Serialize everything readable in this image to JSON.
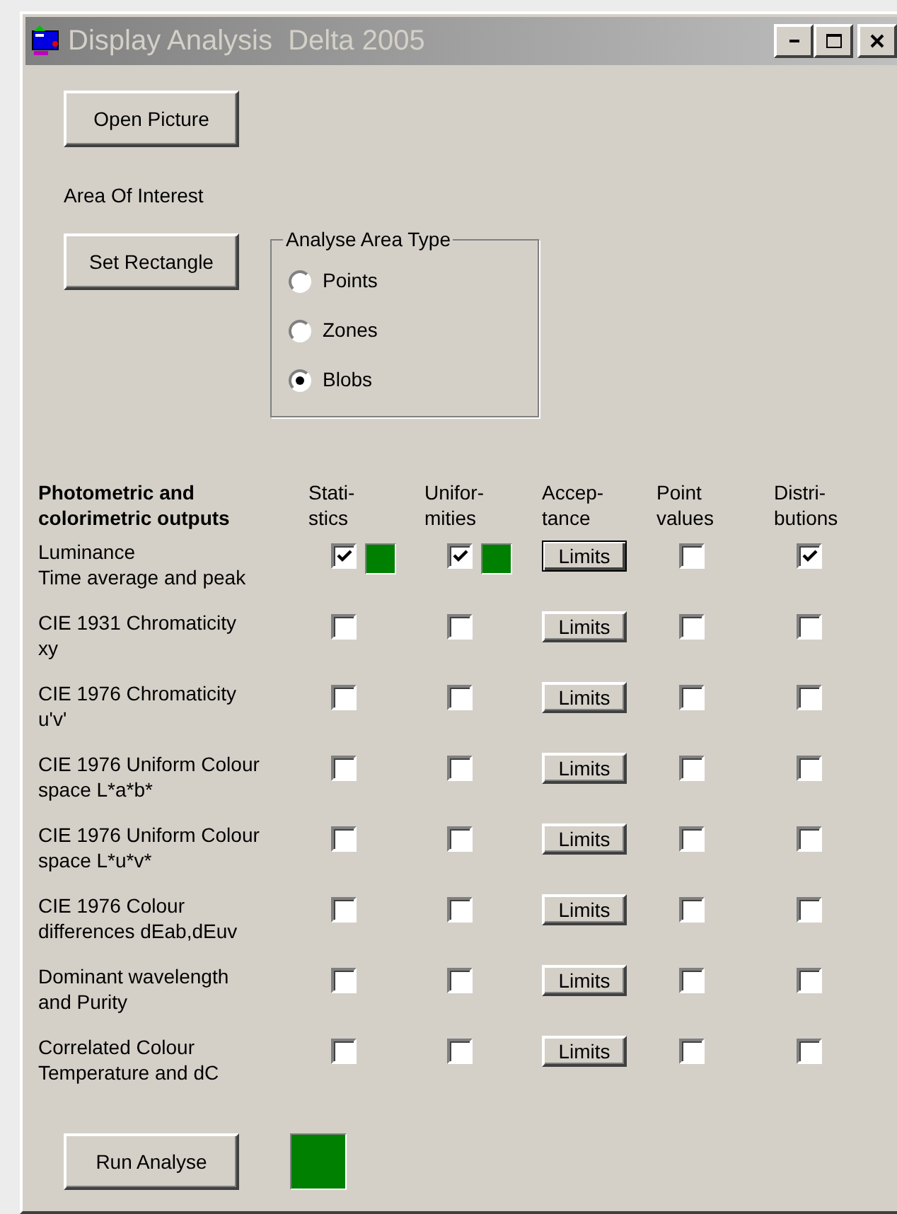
{
  "window": {
    "title": "Display Analysis  Delta 2005"
  },
  "open_button": "Open Picture",
  "area_label": "Area Of Interest",
  "set_rectangle_button": "Set Rectangle",
  "area_type": {
    "legend": "Analyse Area Type",
    "options": [
      {
        "label": "Points",
        "selected": false
      },
      {
        "label": "Zones",
        "selected": false
      },
      {
        "label": "Blobs",
        "selected": true
      }
    ]
  },
  "outputs": {
    "heading": [
      "Photometric and",
      "colorimetric outputs"
    ],
    "columns": [
      {
        "kind": "check",
        "lines": [
          "Stati-",
          "stics"
        ]
      },
      {
        "kind": "check",
        "lines": [
          "Unifor-",
          "mities"
        ]
      },
      {
        "kind": "button",
        "lines": [
          "Accep-",
          "tance"
        ]
      },
      {
        "kind": "check",
        "lines": [
          "Point",
          "values"
        ]
      },
      {
        "kind": "check",
        "lines": [
          "Distri-",
          "butions"
        ]
      }
    ],
    "rows": [
      {
        "lines": [
          "Luminance",
          "Time average and peak"
        ],
        "statistics": {
          "checked": true,
          "indicator": true
        },
        "uniformities": {
          "checked": true,
          "indicator": true
        },
        "limits": {
          "label": "Limits",
          "default": true
        },
        "point_values": {
          "checked": false
        },
        "distributions": {
          "checked": true
        }
      },
      {
        "lines": [
          "CIE 1931 Chromaticity",
          "xy"
        ],
        "statistics": {
          "checked": false
        },
        "uniformities": {
          "checked": false
        },
        "limits": {
          "label": "Limits",
          "default": false
        },
        "point_values": {
          "checked": false
        },
        "distributions": {
          "checked": false
        }
      },
      {
        "lines": [
          "CIE 1976 Chromaticity",
          "u'v'"
        ],
        "statistics": {
          "checked": false
        },
        "uniformities": {
          "checked": false
        },
        "limits": {
          "label": "Limits",
          "default": false
        },
        "point_values": {
          "checked": false
        },
        "distributions": {
          "checked": false
        }
      },
      {
        "lines": [
          "CIE 1976 Uniform Colour",
          "space L*a*b*"
        ],
        "statistics": {
          "checked": false
        },
        "uniformities": {
          "checked": false
        },
        "limits": {
          "label": "Limits",
          "default": false
        },
        "point_values": {
          "checked": false
        },
        "distributions": {
          "checked": false
        }
      },
      {
        "lines": [
          "CIE 1976 Uniform Colour",
          "space L*u*v*"
        ],
        "statistics": {
          "checked": false
        },
        "uniformities": {
          "checked": false
        },
        "limits": {
          "label": "Limits",
          "default": false
        },
        "point_values": {
          "checked": false
        },
        "distributions": {
          "checked": false
        }
      },
      {
        "lines": [
          "CIE 1976 Colour",
          "differences dEab,dEuv"
        ],
        "statistics": {
          "checked": false
        },
        "uniformities": {
          "checked": false
        },
        "limits": {
          "label": "Limits",
          "default": false
        },
        "point_values": {
          "checked": false
        },
        "distributions": {
          "checked": false
        }
      },
      {
        "lines": [
          "Dominant wavelength",
          "and Purity"
        ],
        "statistics": {
          "checked": false
        },
        "uniformities": {
          "checked": false
        },
        "limits": {
          "label": "Limits",
          "default": false
        },
        "point_values": {
          "checked": false
        },
        "distributions": {
          "checked": false
        }
      },
      {
        "lines": [
          "Correlated Colour",
          "Temperature and dC"
        ],
        "statistics": {
          "checked": false
        },
        "uniformities": {
          "checked": false
        },
        "limits": {
          "label": "Limits",
          "default": false
        },
        "point_values": {
          "checked": false
        },
        "distributions": {
          "checked": false
        }
      }
    ]
  },
  "run_button": "Run Analyse",
  "run_indicator": true
}
